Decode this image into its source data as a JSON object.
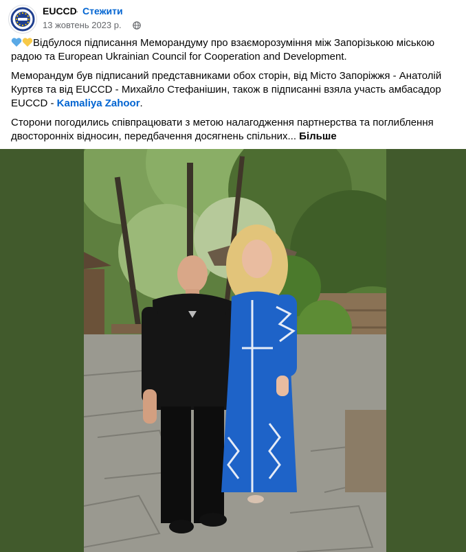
{
  "header": {
    "page_name": "EUCCD",
    "separator": "·",
    "follow_label": "Стежити",
    "date": "13 жовтень 2023 р."
  },
  "post": {
    "para1": "Відбулося підписання Меморандуму про взаєморозуміння між Запорізькою  міською радою та European Ukrainian Council for Cooperation and Development.",
    "para2_before": "Меморандум був підписаний представниками обох сторін, від Місто Запоріжжя - Анатолій Куртєв та від EUCCD - Михайло Стефанішин, також в підписанні взяла участь амбасадор EUCCD - ",
    "para2_mention": "Kamaliya Zahoor",
    "para2_after": ".",
    "para3": "Сторони погодились співпрацювати з метою налагодження партнерства та поглиблення двосторонніх відносин, передбачення досягнень спільних...",
    "more_label": "Більше"
  },
  "colors": {
    "link_blue": "#0064d1",
    "photo_border_green": "#415a2c",
    "heart_blue": "#5aa9e6",
    "heart_yellow": "#f7c948"
  },
  "icons": [
    "eu-ccd-logo-icon",
    "globe-icon",
    "blue-heart-emoji",
    "yellow-heart-emoji"
  ]
}
